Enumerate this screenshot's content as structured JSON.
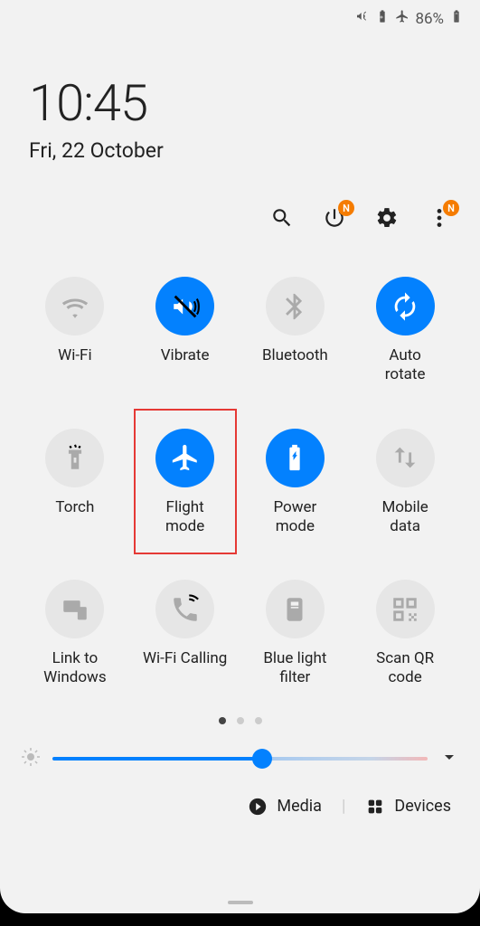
{
  "status": {
    "battery_pct": "86%"
  },
  "clock": {
    "time": "10:45",
    "date": "Fri, 22 October"
  },
  "toolbar": {
    "power_badge": "N",
    "more_badge": "N"
  },
  "tiles": [
    {
      "label": "Wi-Fi",
      "on": false,
      "icon": "wifi",
      "highlight": false
    },
    {
      "label": "Vibrate",
      "on": true,
      "icon": "vibrate",
      "highlight": false
    },
    {
      "label": "Bluetooth",
      "on": false,
      "icon": "bluetooth",
      "highlight": false
    },
    {
      "label": "Auto\nrotate",
      "on": true,
      "icon": "autorotate",
      "highlight": false
    },
    {
      "label": "Torch",
      "on": false,
      "icon": "torch",
      "highlight": false
    },
    {
      "label": "Flight\nmode",
      "on": true,
      "icon": "airplane",
      "highlight": true
    },
    {
      "label": "Power\nmode",
      "on": true,
      "icon": "power",
      "highlight": false
    },
    {
      "label": "Mobile\ndata",
      "on": false,
      "icon": "mobiledata",
      "highlight": false
    },
    {
      "label": "Link to\nWindows",
      "on": false,
      "icon": "linkwindows",
      "highlight": false
    },
    {
      "label": "Wi-Fi Calling",
      "on": false,
      "icon": "wificalling",
      "highlight": false
    },
    {
      "label": "Blue light\nfilter",
      "on": false,
      "icon": "bluelight",
      "highlight": false
    },
    {
      "label": "Scan QR\ncode",
      "on": false,
      "icon": "qr",
      "highlight": false
    }
  ],
  "brightness": {
    "value": 56
  },
  "bottom": {
    "media_label": "Media",
    "devices_label": "Devices"
  }
}
